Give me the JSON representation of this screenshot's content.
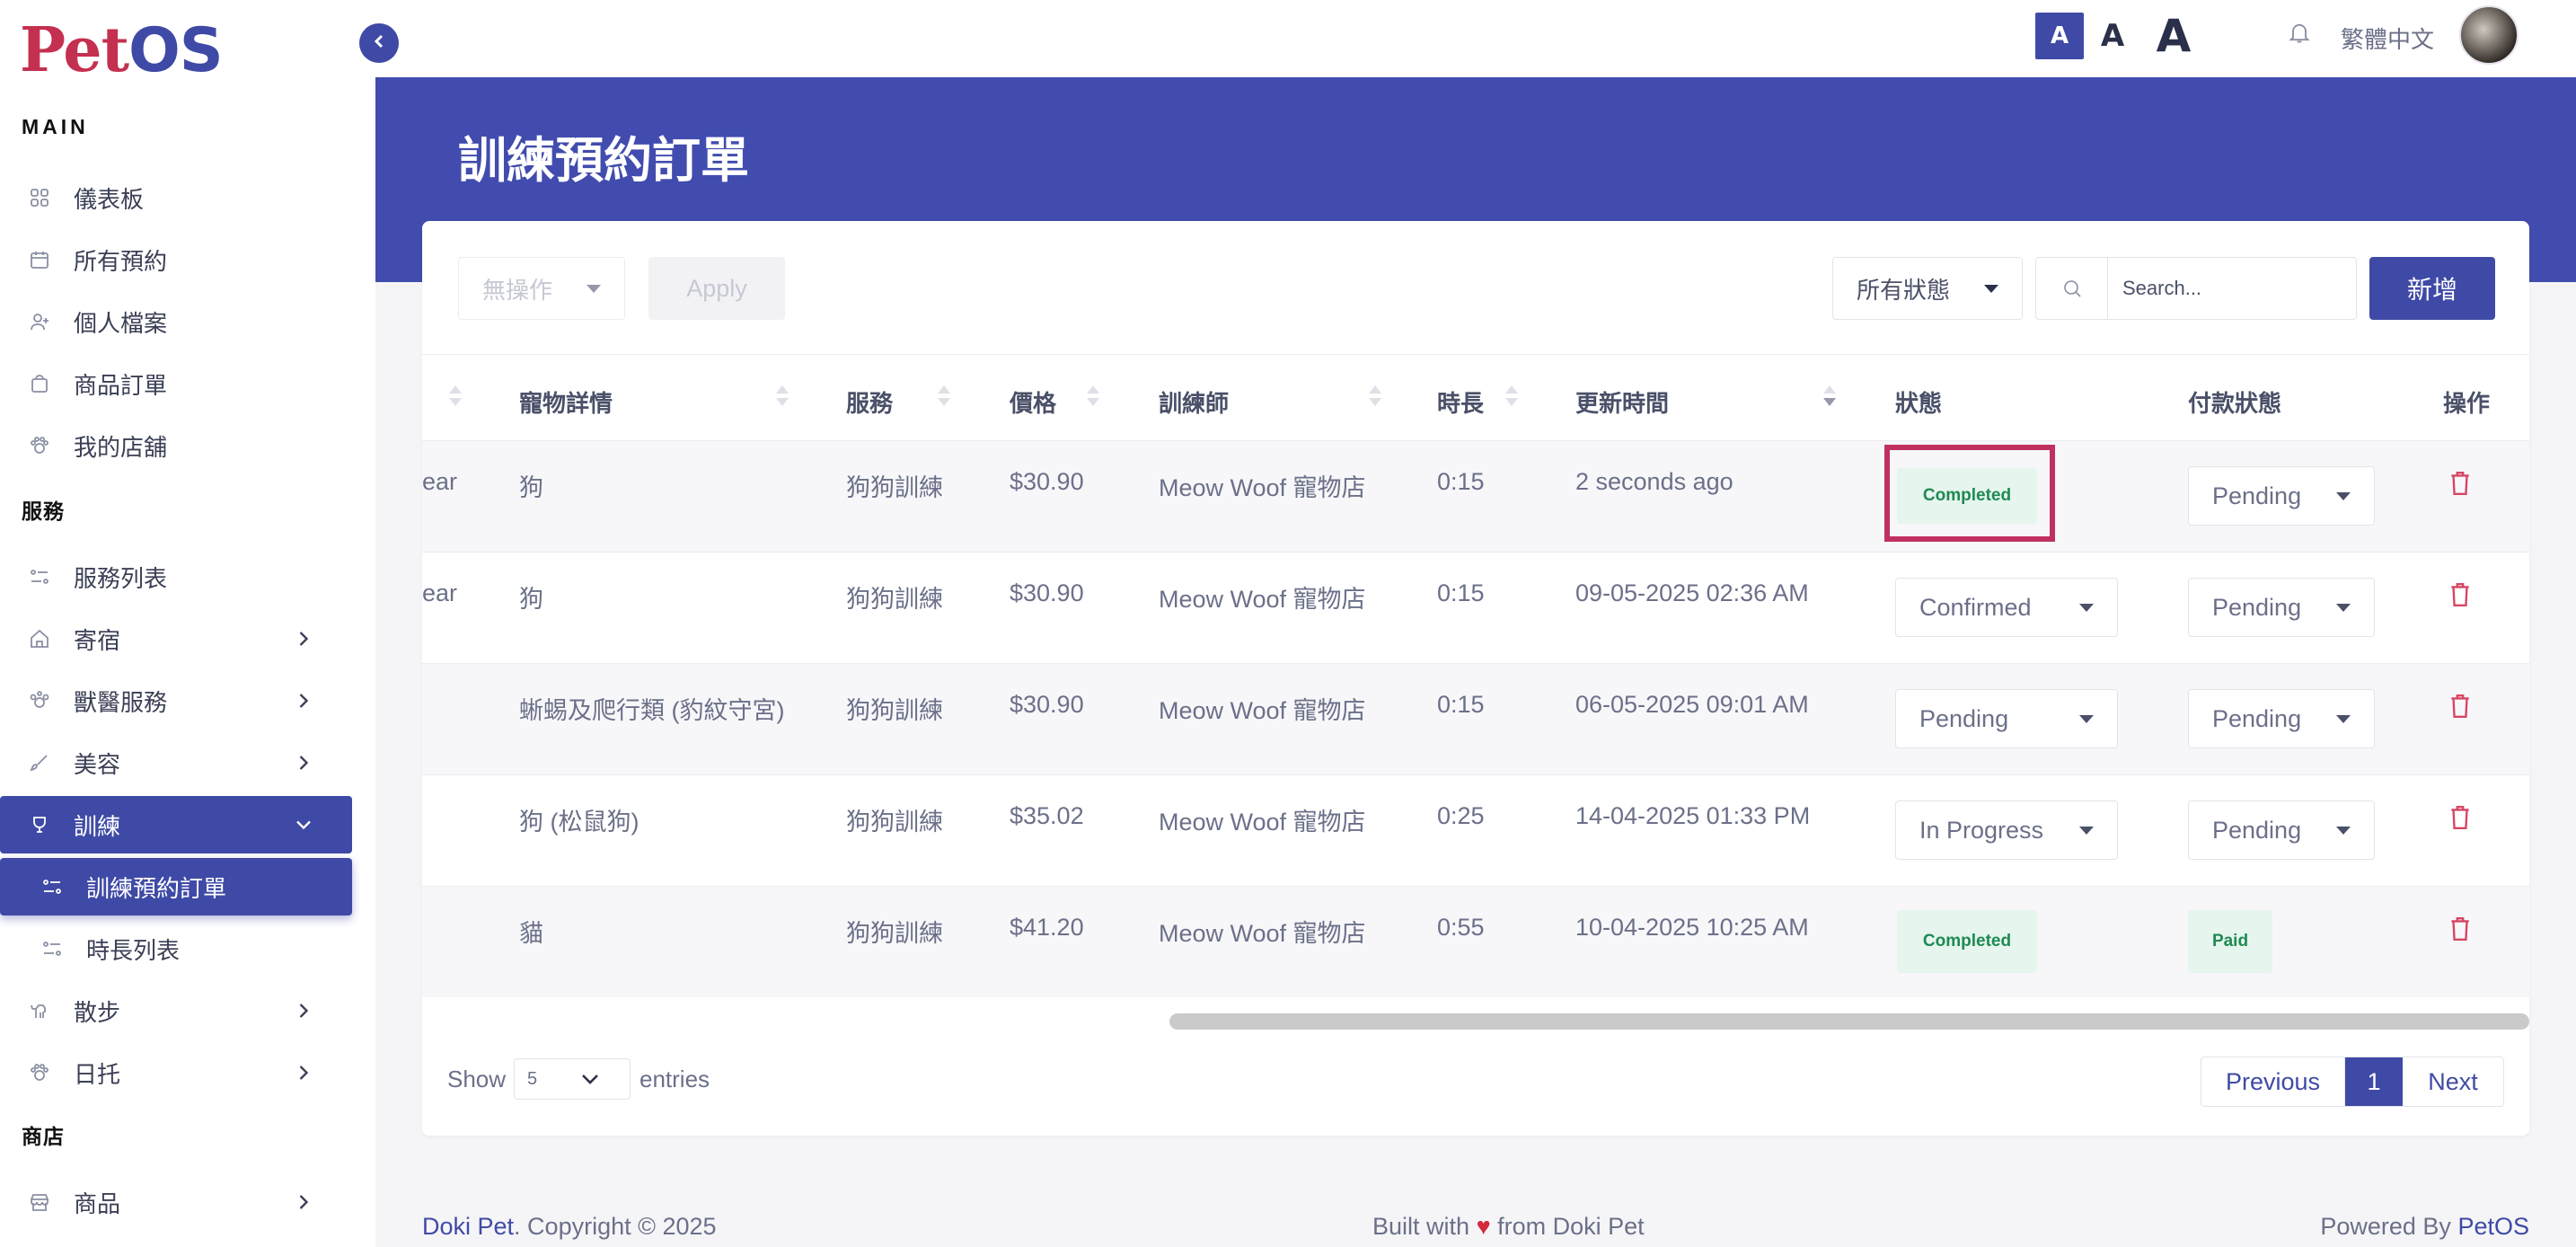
{
  "brand": {
    "logo_pet": "Pet",
    "logo_os": "OS"
  },
  "sidebar": {
    "sections": {
      "main": "MAIN",
      "services": "服務",
      "shop": "商店"
    },
    "items": [
      {
        "label": "儀表板",
        "icon": "grid-icon"
      },
      {
        "label": "所有預約",
        "icon": "calendar-icon"
      },
      {
        "label": "個人檔案",
        "icon": "user-icon"
      },
      {
        "label": "商品訂單",
        "icon": "bag-icon"
      },
      {
        "label": "我的店舖",
        "icon": "paw-icon"
      },
      {
        "label": "服務列表",
        "icon": "list-icon"
      },
      {
        "label": "寄宿",
        "icon": "house-icon",
        "has_children": true
      },
      {
        "label": "獸醫服務",
        "icon": "vet-icon",
        "has_children": true
      },
      {
        "label": "美容",
        "icon": "brush-icon",
        "has_children": true
      },
      {
        "label": "訓練",
        "icon": "training-icon",
        "has_children": true,
        "expanded": true
      },
      {
        "label": "訓練預約訂單",
        "icon": "list-icon",
        "sub": true,
        "active": true
      },
      {
        "label": "時長列表",
        "icon": "list-icon",
        "sub": true
      },
      {
        "label": "散步",
        "icon": "walk-icon",
        "has_children": true
      },
      {
        "label": "日托",
        "icon": "paw-icon",
        "has_children": true
      },
      {
        "label": "商品",
        "icon": "store-icon",
        "has_children": true
      }
    ]
  },
  "topbar": {
    "font_size_small": "A",
    "font_size_medium": "A",
    "font_size_large": "A",
    "language": "繁體中文"
  },
  "page": {
    "title": "訓練預約訂單"
  },
  "toolbar": {
    "bulk_action": "無操作",
    "apply": "Apply",
    "status_filter": "所有狀態",
    "search_placeholder": "Search...",
    "add": "新增"
  },
  "table": {
    "columns": [
      "寵物詳情",
      "服務",
      "價格",
      "訓練師",
      "時長",
      "更新時間",
      "狀態",
      "付款狀態",
      "操作"
    ],
    "rows": [
      {
        "pet_name_partial": "ear",
        "pet": "狗",
        "service": "狗狗訓練",
        "price": "$30.90",
        "trainer": "Meow Woof 寵物店",
        "duration": "0:15",
        "updated": "2 seconds ago",
        "status": "Completed",
        "payment": "Pending"
      },
      {
        "pet_name_partial": "ear",
        "pet": "狗",
        "service": "狗狗訓練",
        "price": "$30.90",
        "trainer": "Meow Woof 寵物店",
        "duration": "0:15",
        "updated": "09-05-2025 02:36 AM",
        "status": "Confirmed",
        "payment": "Pending"
      },
      {
        "pet_name_partial": "",
        "pet": "蜥蜴及爬行類 (豹紋守宮)",
        "service": "狗狗訓練",
        "price": "$30.90",
        "trainer": "Meow Woof 寵物店",
        "duration": "0:15",
        "updated": "06-05-2025 09:01 AM",
        "status": "Pending",
        "payment": "Pending"
      },
      {
        "pet_name_partial": "",
        "pet": "狗 (松鼠狗)",
        "service": "狗狗訓練",
        "price": "$35.02",
        "trainer": "Meow Woof 寵物店",
        "duration": "0:25",
        "updated": "14-04-2025 01:33 PM",
        "status": "In Progress",
        "payment": "Pending"
      },
      {
        "pet_name_partial": "",
        "pet": "貓",
        "service": "狗狗訓練",
        "price": "$41.20",
        "trainer": "Meow Woof 寵物店",
        "duration": "0:55",
        "updated": "10-04-2025 10:25 AM",
        "status": "Completed",
        "payment": "Paid"
      }
    ]
  },
  "pagination": {
    "show": "Show",
    "entries_value": "5",
    "entries": "entries",
    "previous": "Previous",
    "current": "1",
    "next": "Next"
  },
  "footer": {
    "brand": "Doki Pet",
    "copyright": ". Copyright © 2025",
    "built_with": "Built with",
    "heart": "♥",
    "from": "from Doki Pet",
    "powered_by": "Powered By",
    "powered_brand": "PetOS"
  },
  "colors": {
    "primary": "#3f4aa6",
    "brand_red": "#c4304f",
    "success_bg": "#e6f5ee",
    "success_text": "#1e8a52",
    "danger": "#d64563",
    "highlight": "#c0305f"
  }
}
